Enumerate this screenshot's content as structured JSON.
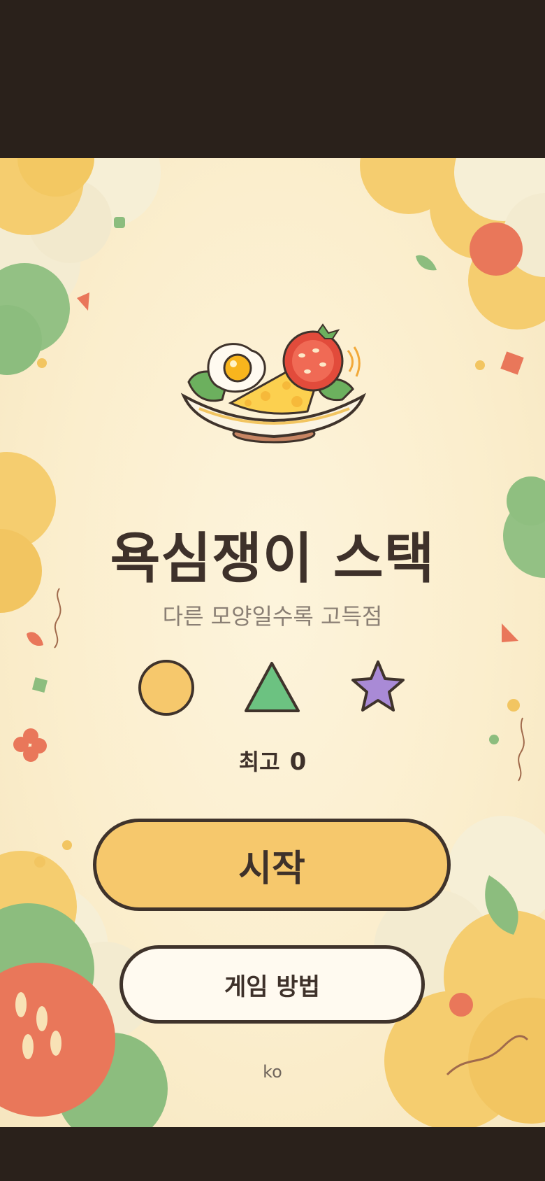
{
  "game": {
    "title": "욕심쟁이 스택",
    "subtitle": "다른 모양일수록 고득점",
    "shapes": [
      "circle-icon",
      "triangle-icon",
      "star-icon"
    ],
    "shape_colors": {
      "circle": "#f6c86c",
      "triangle": "#6cc281",
      "star": "#a98ad6"
    },
    "best_label": "최고",
    "best_score": "0",
    "start_label": "시작",
    "howto_label": "게임 방법",
    "language": "ko"
  },
  "colors": {
    "background": "#fbeecd",
    "frame": "#2a211b",
    "text_dark": "#3e312a",
    "text_muted": "#8a7f74",
    "accent": "#f6c86c"
  }
}
